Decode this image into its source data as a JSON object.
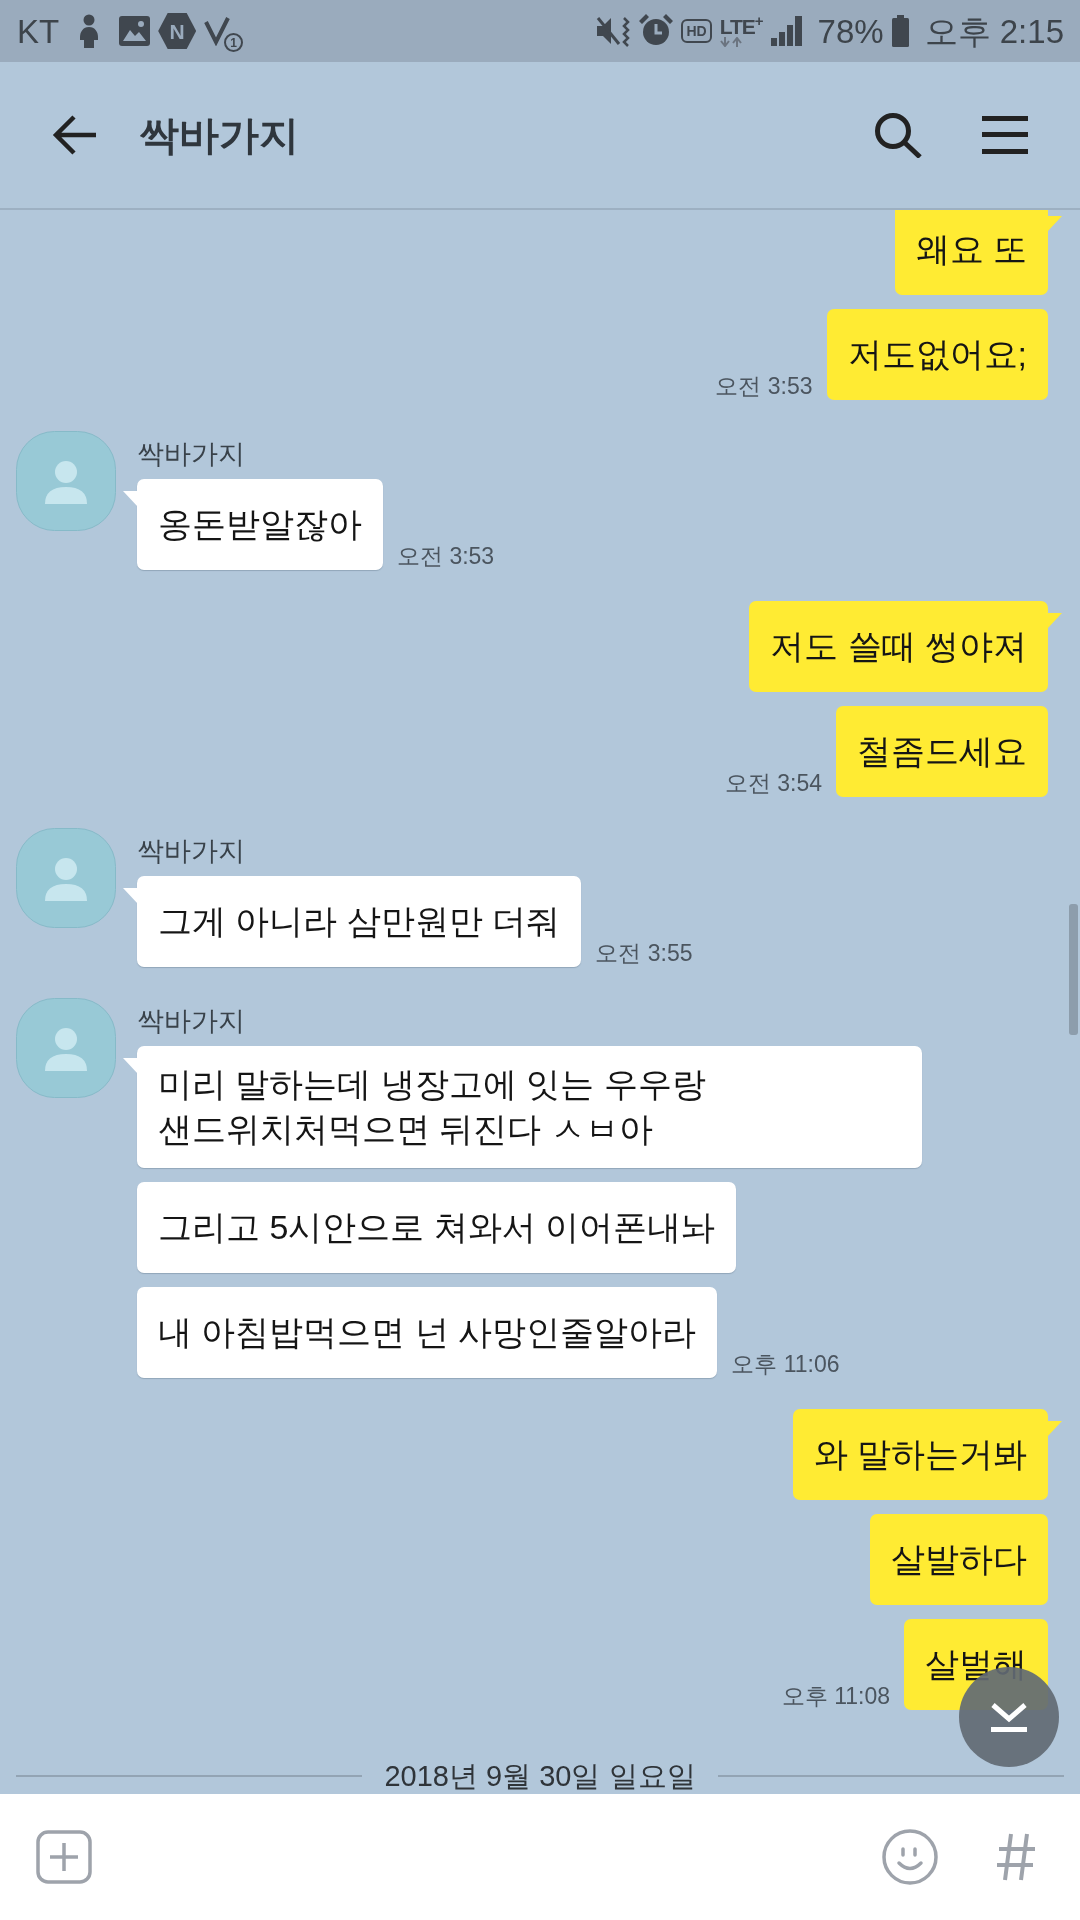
{
  "status_bar": {
    "carrier": "KT",
    "app_icon_letter": "N",
    "missed_count": "1",
    "hd_label": "HD",
    "network": "LTE$^{+}$",
    "battery": "78%",
    "time": "오후 2:15"
  },
  "header": {
    "title": "싹바가지"
  },
  "messages": [
    {
      "kind": "sent",
      "bubbles": [
        "왜요 또",
        "저도없어요;"
      ],
      "time": "오전 3:53"
    },
    {
      "kind": "received",
      "sender": "싹바가지",
      "bubbles": [
        "옹돈받알잖아"
      ],
      "time": "오전 3:53"
    },
    {
      "kind": "sent",
      "bubbles": [
        "저도 쓸때 썽야져",
        "철좀드세요"
      ],
      "time": "오전 3:54"
    },
    {
      "kind": "received",
      "sender": "싹바가지",
      "bubbles": [
        "그게 아니라 삼만원만 더줘"
      ],
      "time": "오전 3:55"
    },
    {
      "kind": "received",
      "sender": "싹바가지",
      "bubbles": [
        "미리 말하는데 냉장고에 잇는 우우랑 샌드위치처먹으면 뒤진다 ㅅㅂ아",
        "그리고 5시안으로 쳐와서 이어폰내놔",
        "내 아침밥먹으면 넌 사망인줄알아라"
      ],
      "time": "오후 11:06"
    },
    {
      "kind": "sent",
      "bubbles": [
        "와 말하는거봐",
        "살발하다",
        "살벌해"
      ],
      "time": "오후 11:08"
    },
    {
      "kind": "date",
      "text": "2018년 9월 30일 일요일"
    }
  ]
}
